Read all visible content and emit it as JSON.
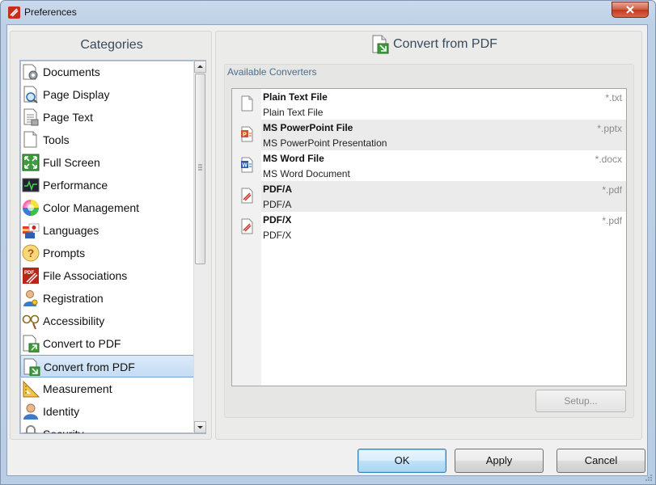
{
  "window": {
    "title": "Preferences"
  },
  "categories": {
    "heading": "Categories",
    "items": [
      {
        "label": "Documents",
        "icon": "documents-gear-icon"
      },
      {
        "label": "Page Display",
        "icon": "page-magnifier-icon"
      },
      {
        "label": "Page Text",
        "icon": "page-text-icon"
      },
      {
        "label": "Tools",
        "icon": "tools-page-icon"
      },
      {
        "label": "Full Screen",
        "icon": "full-screen-icon"
      },
      {
        "label": "Performance",
        "icon": "performance-monitor-icon"
      },
      {
        "label": "Color Management",
        "icon": "color-wheel-icon"
      },
      {
        "label": "Languages",
        "icon": "flags-icon"
      },
      {
        "label": "Prompts",
        "icon": "question-icon"
      },
      {
        "label": "File Associations",
        "icon": "pdf-file-icon"
      },
      {
        "label": "Registration",
        "icon": "user-key-icon"
      },
      {
        "label": "Accessibility",
        "icon": "glasses-icon"
      },
      {
        "label": "Convert to PDF",
        "icon": "convert-to-pdf-icon"
      },
      {
        "label": "Convert from PDF",
        "icon": "convert-from-pdf-icon",
        "selected": true
      },
      {
        "label": "Measurement",
        "icon": "ruler-triangle-icon"
      },
      {
        "label": "Identity",
        "icon": "identity-user-icon"
      },
      {
        "label": "Security",
        "icon": "security-lock-icon"
      }
    ]
  },
  "panel": {
    "heading": "Convert from PDF",
    "group_title": "Available Converters",
    "converters": [
      {
        "name": "Plain Text File",
        "desc": "Plain Text File",
        "ext": "*.txt",
        "icon": "text-file-icon"
      },
      {
        "name": "MS PowerPoint File",
        "desc": "MS PowerPoint Presentation",
        "ext": "*.pptx",
        "icon": "powerpoint-file-icon"
      },
      {
        "name": "MS Word File",
        "desc": "MS Word Document",
        "ext": "*.docx",
        "icon": "word-file-icon"
      },
      {
        "name": "PDF/A",
        "desc": "PDF/A",
        "ext": "*.pdf",
        "icon": "pdf-file-icon"
      },
      {
        "name": "PDF/X",
        "desc": "PDF/X",
        "ext": "*.pdf",
        "icon": "pdf-file-icon"
      }
    ],
    "setup_label": "Setup..."
  },
  "buttons": {
    "ok": "OK",
    "apply": "Apply",
    "cancel": "Cancel"
  },
  "colors": {
    "selection": "#c4dcf4",
    "heading": "#3a4a5c",
    "group_title": "#4a6c8d",
    "close": "#c0391e"
  }
}
